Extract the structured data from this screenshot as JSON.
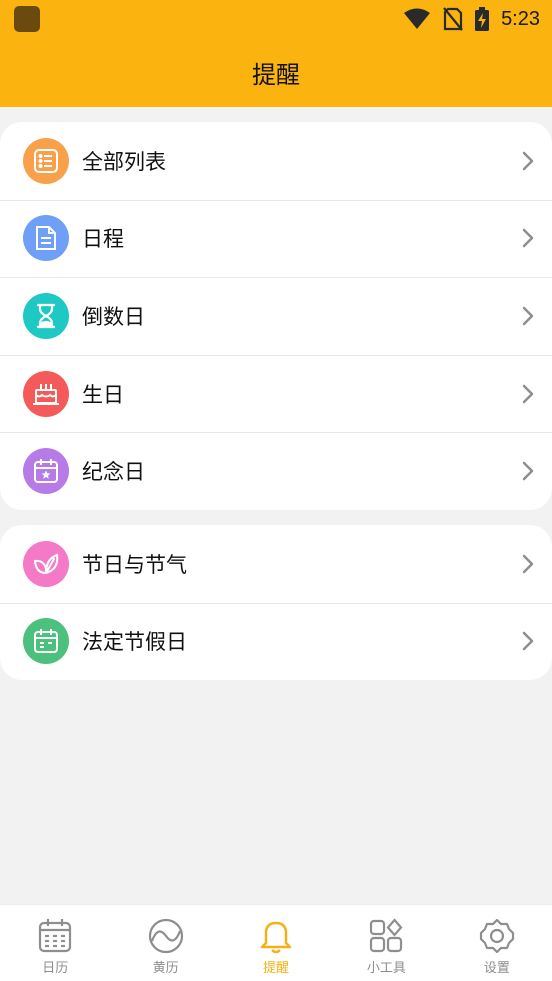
{
  "status_bar": {
    "time": "5:23"
  },
  "header": {
    "title": "提醒"
  },
  "groups": [
    {
      "items": [
        {
          "label": "全部列表",
          "icon": "list-icon",
          "color": "#f8a14a"
        },
        {
          "label": "日程",
          "icon": "document-icon",
          "color": "#6f9ff6"
        },
        {
          "label": "倒数日",
          "icon": "hourglass-icon",
          "color": "#1ec9c4"
        },
        {
          "label": "生日",
          "icon": "cake-icon",
          "color": "#f45a5a"
        },
        {
          "label": "纪念日",
          "icon": "calendar-star-icon",
          "color": "#b77be8"
        }
      ]
    },
    {
      "items": [
        {
          "label": "节日与节气",
          "icon": "leaf-icon",
          "color": "#f47ac8"
        },
        {
          "label": "法定节假日",
          "icon": "calendar-holiday-icon",
          "color": "#4cc07d"
        }
      ]
    }
  ],
  "tabs": [
    {
      "label": "日历",
      "icon": "calendar-icon",
      "active": false
    },
    {
      "label": "黄历",
      "icon": "almanac-icon",
      "active": false
    },
    {
      "label": "提醒",
      "icon": "bell-icon",
      "active": true
    },
    {
      "label": "小工具",
      "icon": "tools-grid-icon",
      "active": false
    },
    {
      "label": "设置",
      "icon": "settings-gear-icon",
      "active": false
    }
  ],
  "colors": {
    "accent": "#fbb40f",
    "active_tab": "#f6b014",
    "inactive_tab": "#8e8e8e",
    "background": "#f2f2f2"
  }
}
